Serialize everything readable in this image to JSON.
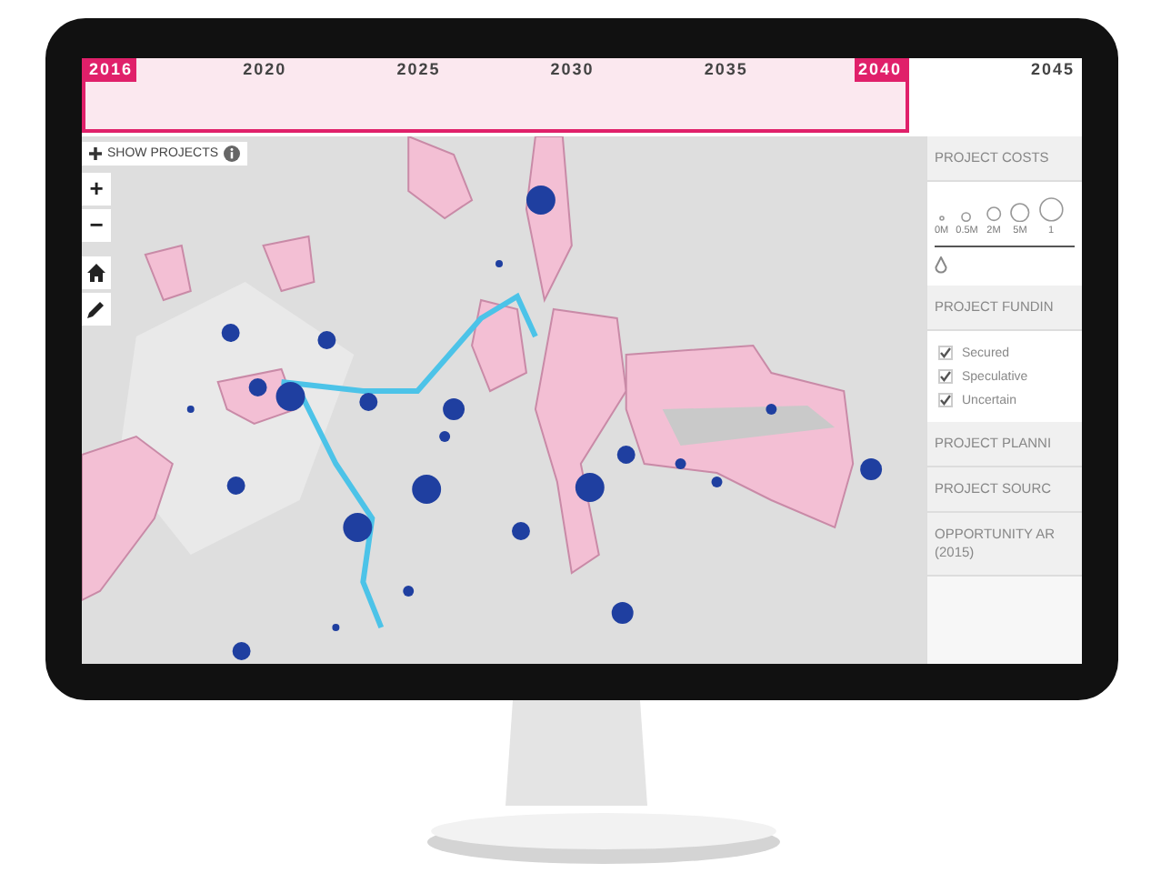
{
  "timeline": {
    "range": [
      {
        "label": "2016",
        "selected": true
      },
      {
        "label": "2020",
        "selected": false
      },
      {
        "label": "2025",
        "selected": false
      },
      {
        "label": "2030",
        "selected": false
      },
      {
        "label": "2035",
        "selected": false
      },
      {
        "label": "2040",
        "selected": true
      }
    ],
    "after": [
      {
        "label": "2045"
      }
    ]
  },
  "map_controls": {
    "show_projects": "SHOW PROJECTS",
    "zoom_in": "+",
    "zoom_out": "−"
  },
  "sidebar": {
    "costs": {
      "title": "PROJECT COSTS",
      "sizes": [
        "0M",
        "0.5M",
        "2M",
        "5M",
        "1"
      ]
    },
    "funding": {
      "title": "PROJECT FUNDIN",
      "options": [
        {
          "label": "Secured",
          "checked": true
        },
        {
          "label": "Speculative",
          "checked": true
        },
        {
          "label": "Uncertain",
          "checked": true
        }
      ]
    },
    "sections": [
      "PROJECT PLANNI",
      "PROJECT SOURC",
      "OPPORTUNITY AR (2015)"
    ]
  }
}
